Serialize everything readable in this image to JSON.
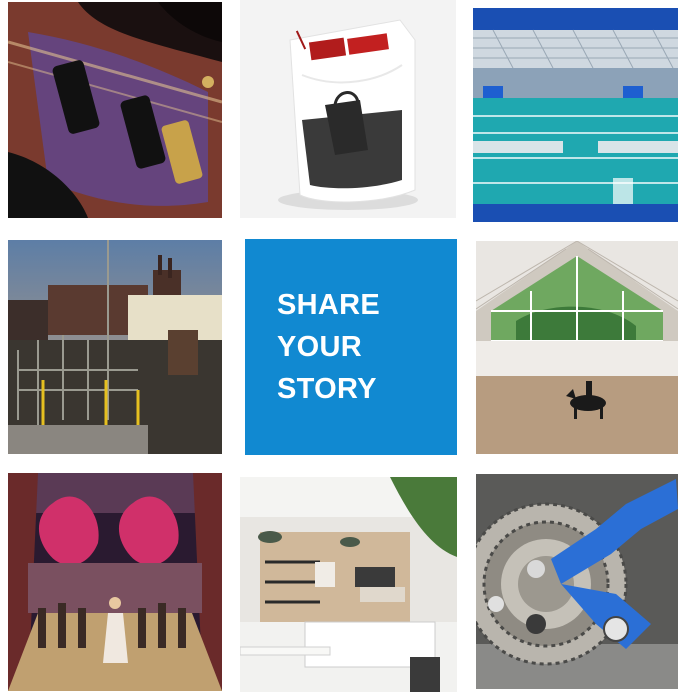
{
  "grid": {
    "tiles": [
      {
        "id": "guitar",
        "icon": "carved-electric-guitar-photo"
      },
      {
        "id": "storage",
        "icon": "white-bag-organizer-photo"
      },
      {
        "id": "pool",
        "icon": "indoor-swimming-pool-photo"
      },
      {
        "id": "industrial",
        "icon": "industrial-plant-at-dusk-photo"
      },
      {
        "id": "cta",
        "icon": "text-tile"
      },
      {
        "id": "riding-arena",
        "icon": "indoor-horse-arena-photo"
      },
      {
        "id": "theater",
        "icon": "theater-stage-performance-photo"
      },
      {
        "id": "cafe",
        "icon": "cafe-interior-photo"
      },
      {
        "id": "bicycle",
        "icon": "bicycle-derailleur-closeup-photo"
      }
    ],
    "cta": {
      "line1": "SHARE",
      "line2": "YOUR",
      "line3": "STORY",
      "background": "#1189d1",
      "text_color": "#ffffff"
    }
  }
}
